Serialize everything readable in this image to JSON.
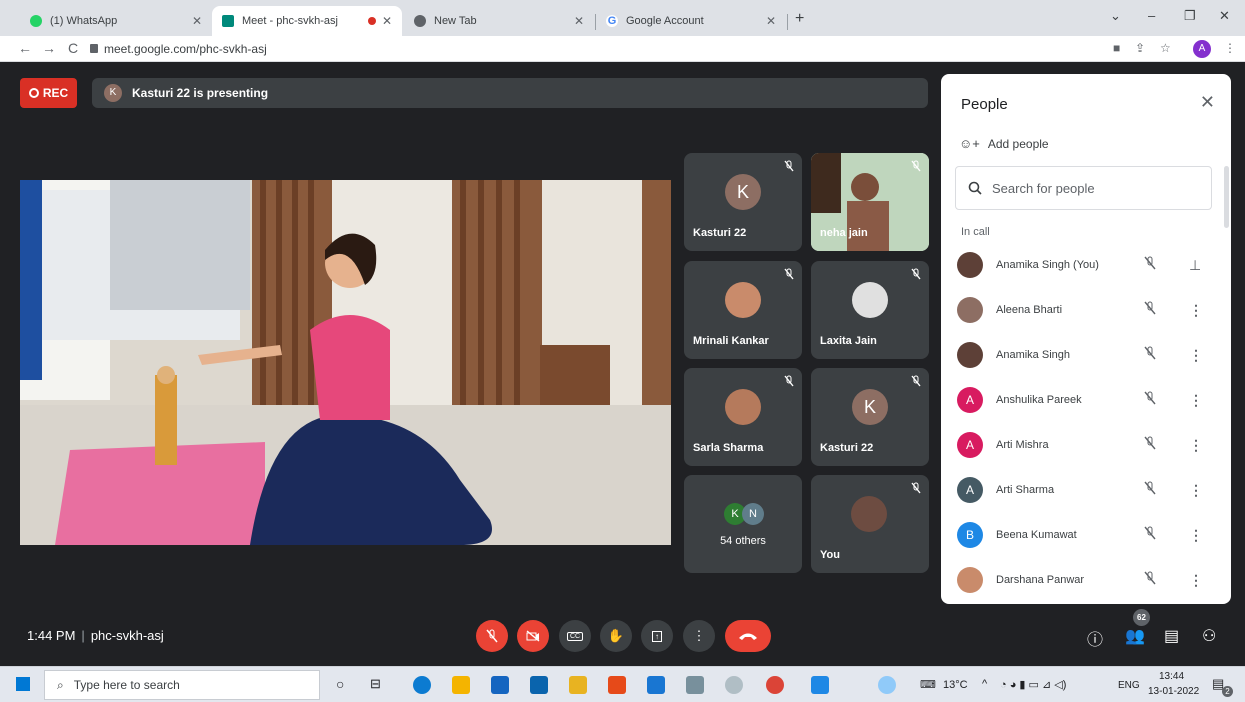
{
  "browser": {
    "tabs": [
      {
        "title": "(1) WhatsApp",
        "color": "#25d366"
      },
      {
        "title": "Meet - phc-svkh-asj",
        "color": "#00897b"
      },
      {
        "title": "New Tab",
        "color": "#5f6368"
      },
      {
        "title": "Google Account",
        "color": "#4285f4"
      }
    ],
    "url": "meet.google.com/phc-svkh-asj",
    "profile_initial": "A"
  },
  "meet": {
    "rec_label": "REC",
    "presenter_initial": "K",
    "presenting_text": "Kasturi 22 is presenting",
    "tiles": [
      {
        "name": "Kasturi 22",
        "initial": "K",
        "color": "#8d6e63"
      },
      {
        "name": "neha jain",
        "initial": "",
        "color": ""
      },
      {
        "name": "Mrinali Kankar",
        "initial": "",
        "color": "#c98b6b"
      },
      {
        "name": "Laxita Jain",
        "initial": "",
        "color": "#e0e0e0"
      },
      {
        "name": "Sarla Sharma",
        "initial": "",
        "color": "#b57a5c"
      },
      {
        "name": "Kasturi 22",
        "initial": "K",
        "color": "#8d6e63"
      },
      {
        "name": "54 others",
        "initial": "",
        "color": ""
      },
      {
        "name": "You",
        "initial": "",
        "color": "#6d4c41"
      }
    ],
    "others_initials": [
      "K",
      "N"
    ],
    "time": "1:44 PM",
    "meeting_code": "phc-svkh-asj",
    "participant_count": "62"
  },
  "people_panel": {
    "title": "People",
    "add_people": "Add people",
    "search_placeholder": "Search for people",
    "section": "In call",
    "participants": [
      {
        "name": "Anamika Singh (You)",
        "initial": "",
        "color": "#5d4037",
        "action": "pin-icon"
      },
      {
        "name": "Aleena Bharti",
        "initial": "",
        "color": "#8d6e63",
        "action": "more-vert-icon"
      },
      {
        "name": "Anamika Singh",
        "initial": "",
        "color": "#5d4037",
        "action": "more-vert-icon"
      },
      {
        "name": "Anshulika Pareek",
        "initial": "A",
        "color": "#d81b60",
        "action": "more-vert-icon"
      },
      {
        "name": "Arti Mishra",
        "initial": "A",
        "color": "#d81b60",
        "action": "more-vert-icon"
      },
      {
        "name": "Arti Sharma",
        "initial": "A",
        "color": "#455a64",
        "action": "more-vert-icon"
      },
      {
        "name": "Beena Kumawat",
        "initial": "B",
        "color": "#1e88e5",
        "action": "more-vert-icon"
      },
      {
        "name": "Darshana Panwar",
        "initial": "",
        "color": "#c98b6b",
        "action": "more-vert-icon"
      }
    ]
  },
  "taskbar": {
    "search_placeholder": "Type here to search",
    "temperature": "13°C",
    "language": "ENG",
    "time": "13:44",
    "date": "13-01-2022",
    "notification_count": "2"
  }
}
